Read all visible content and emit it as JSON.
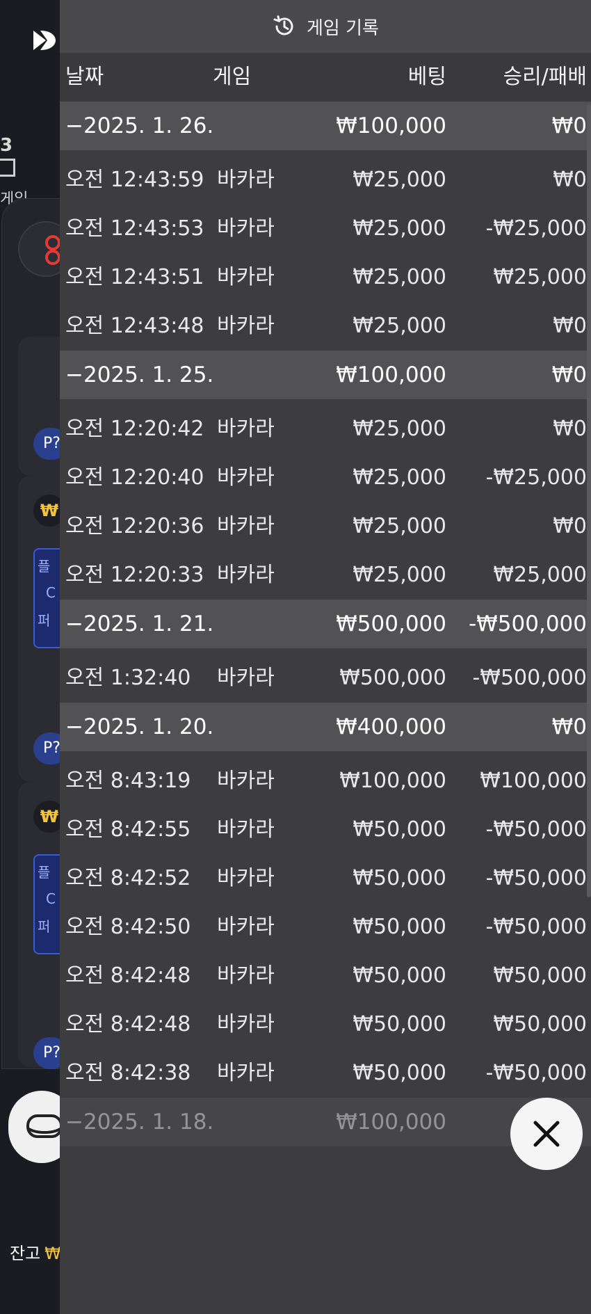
{
  "background": {
    "number_label": "3",
    "game_label": "게임",
    "p_badges": [
      "P?",
      "P?",
      "P?"
    ],
    "won_symbol": "₩",
    "blue_box_lines": [
      "플",
      "C",
      "퍼"
    ],
    "balance_label": "잔고",
    "balance_value": "₩"
  },
  "history": {
    "title": "게임 기록",
    "title_icon": "history-clock-icon",
    "columns": {
      "date": "날짜",
      "game": "게임",
      "bet": "베팅",
      "win_loss": "승리/패배"
    },
    "groups": [
      {
        "date": "−2025. 1. 26.",
        "total_bet": "₩100,000",
        "total_win": "₩0",
        "entries": [
          {
            "time": "오전 12:43:59",
            "game": "바카라",
            "bet": "₩25,000",
            "win": "₩0"
          },
          {
            "time": "오전 12:43:53",
            "game": "바카라",
            "bet": "₩25,000",
            "win": "-₩25,000"
          },
          {
            "time": "오전 12:43:51",
            "game": "바카라",
            "bet": "₩25,000",
            "win": "₩25,000"
          },
          {
            "time": "오전 12:43:48",
            "game": "바카라",
            "bet": "₩25,000",
            "win": "₩0"
          }
        ]
      },
      {
        "date": "−2025. 1. 25.",
        "total_bet": "₩100,000",
        "total_win": "₩0",
        "entries": [
          {
            "time": "오전 12:20:42",
            "game": "바카라",
            "bet": "₩25,000",
            "win": "₩0"
          },
          {
            "time": "오전 12:20:40",
            "game": "바카라",
            "bet": "₩25,000",
            "win": "-₩25,000"
          },
          {
            "time": "오전 12:20:36",
            "game": "바카라",
            "bet": "₩25,000",
            "win": "₩0"
          },
          {
            "time": "오전 12:20:33",
            "game": "바카라",
            "bet": "₩25,000",
            "win": "₩25,000"
          }
        ]
      },
      {
        "date": "−2025. 1. 21.",
        "total_bet": "₩500,000",
        "total_win": "-₩500,000",
        "entries": [
          {
            "time": "오전 1:32:40",
            "game": "바카라",
            "bet": "₩500,000",
            "win": "-₩500,000"
          }
        ]
      },
      {
        "date": "−2025. 1. 20.",
        "total_bet": "₩400,000",
        "total_win": "₩0",
        "entries": [
          {
            "time": "오전 8:43:19",
            "game": "바카라",
            "bet": "₩100,000",
            "win": "₩100,000"
          },
          {
            "time": "오전 8:42:55",
            "game": "바카라",
            "bet": "₩50,000",
            "win": "-₩50,000"
          },
          {
            "time": "오전 8:42:52",
            "game": "바카라",
            "bet": "₩50,000",
            "win": "-₩50,000"
          },
          {
            "time": "오전 8:42:50",
            "game": "바카라",
            "bet": "₩50,000",
            "win": "-₩50,000"
          },
          {
            "time": "오전 8:42:48",
            "game": "바카라",
            "bet": "₩50,000",
            "win": "₩50,000"
          },
          {
            "time": "오전 8:42:48",
            "game": "바카라",
            "bet": "₩50,000",
            "win": "₩50,000"
          },
          {
            "time": "오전 8:42:38",
            "game": "바카라",
            "bet": "₩50,000",
            "win": "-₩50,000"
          }
        ]
      },
      {
        "date": "−2025. 1. 18.",
        "total_bet": "₩100,000",
        "total_win": "",
        "faded": true,
        "entries": []
      }
    ],
    "close_icon": "close-icon"
  },
  "colors": {
    "overlay_bg": "#3d3d3f",
    "date_row_bg": "#525254",
    "title_bar_bg": "#49494b",
    "accent_gold": "#f3c43a",
    "badge_blue": "#2b3f8f"
  }
}
